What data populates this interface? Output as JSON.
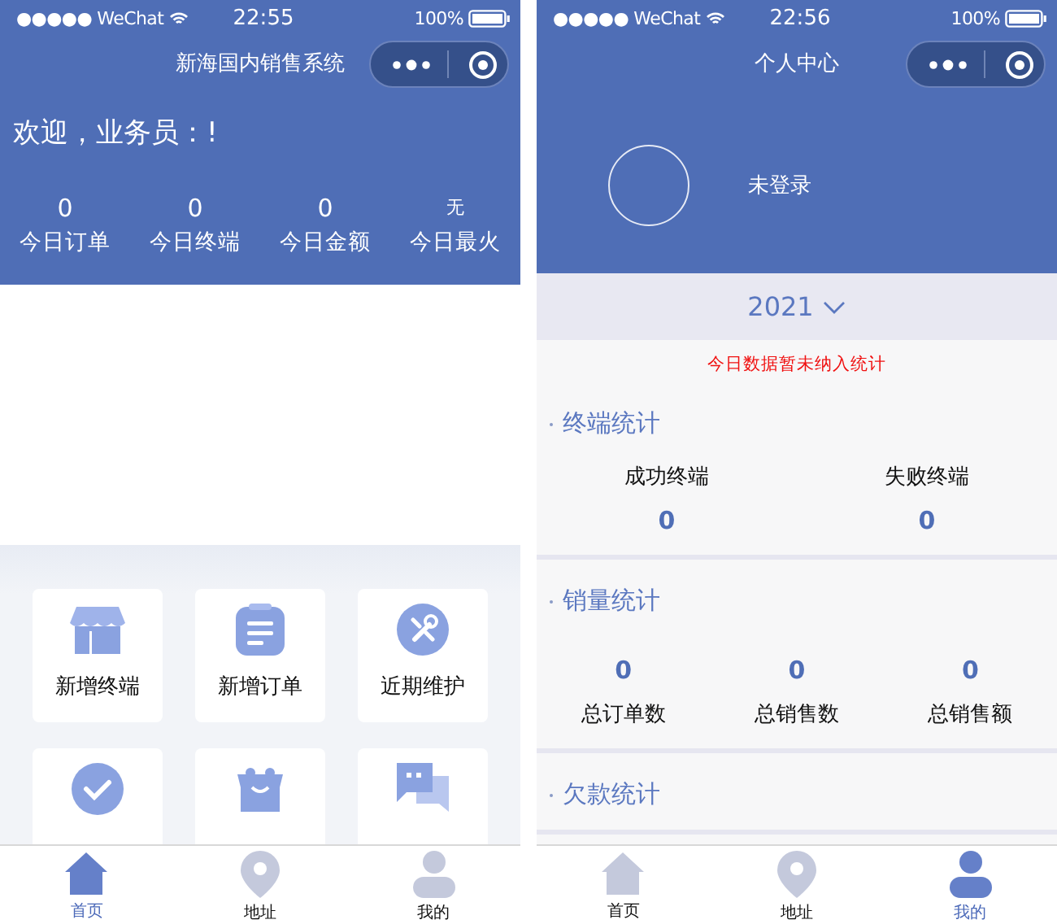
{
  "screens": [
    {
      "kind": "home",
      "status_bar": {
        "carrier": "●●●●● WeChat",
        "time": "22:55",
        "battery": "100%"
      },
      "nav_title": "新海国内销售系统",
      "welcome": "欢迎，业务员：!",
      "stats": [
        {
          "value": "0",
          "label": "今日订单"
        },
        {
          "value": "0",
          "label": "今日终端"
        },
        {
          "value": "0",
          "label": "今日金额"
        },
        {
          "value": "无",
          "label": "今日最火",
          "small": true
        }
      ],
      "grid": [
        {
          "kind": "labeled",
          "label": "新增终端"
        },
        {
          "kind": "labeled",
          "label": "新增订单"
        },
        {
          "kind": "labeled",
          "label": "近期维护"
        },
        {
          "kind": "cut"
        },
        {
          "kind": "cut"
        },
        {
          "kind": "cut"
        }
      ],
      "tab_bar": [
        {
          "label": "首页",
          "selected": true
        },
        {
          "label": "地址",
          "selected": false
        },
        {
          "label": "我的",
          "selected": false
        }
      ]
    },
    {
      "kind": "profile",
      "status_bar": {
        "carrier": "●●●●● WeChat",
        "time": "22:56",
        "battery": "100%"
      },
      "nav_title": "个人中心",
      "user": "未登录",
      "year": "2021",
      "notice": "今日数据暂未纳入统计",
      "sections": [
        {
          "title": "终端统计",
          "kind": "label-first",
          "items": [
            {
              "label": "成功终端",
              "value": "0"
            },
            {
              "label": "失败终端",
              "value": "0"
            }
          ]
        },
        {
          "title": "销量统计",
          "kind": "value-first",
          "items": [
            {
              "label": "总订单数",
              "value": "0"
            },
            {
              "label": "总销售数",
              "value": "0"
            },
            {
              "label": "总销售额",
              "value": "0"
            }
          ]
        },
        {
          "title": "欠款统计",
          "kind": "title-only"
        }
      ],
      "tab_bar": [
        {
          "label": "首页",
          "selected": false
        },
        {
          "label": "地址",
          "selected": false
        },
        {
          "label": "我的",
          "selected": true
        }
      ]
    }
  ]
}
